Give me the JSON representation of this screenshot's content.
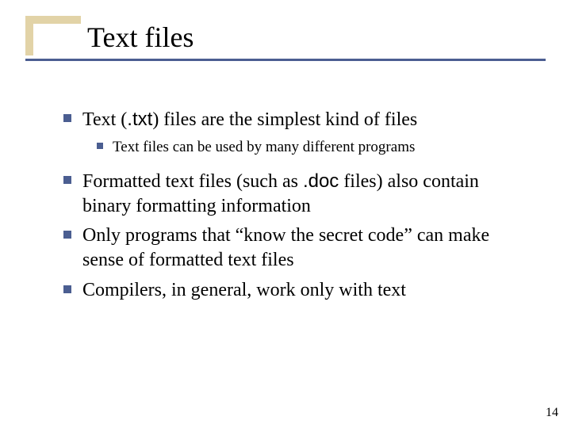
{
  "title": "Text files",
  "bullets": {
    "b1_pre": "Text (",
    "b1_code": ".txt",
    "b1_post": ") files are the simplest kind of files",
    "b1a": "Text files can be used by many different programs",
    "b2_pre": "Formatted text files (such as ",
    "b2_code": ".doc",
    "b2_post": " files) also contain binary formatting information",
    "b3": "Only programs that “know the secret code” can make sense of formatted text files",
    "b4": "Compilers, in general, work only with text"
  },
  "page_number": "14"
}
